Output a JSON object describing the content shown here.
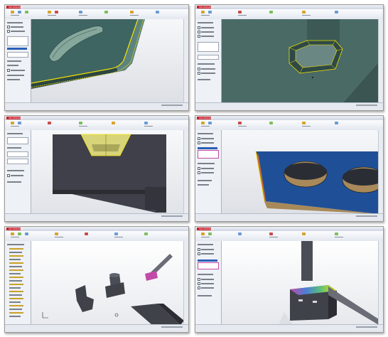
{
  "app": {
    "logo_text": "SOLIDWORKS",
    "accent_red": "#c8202a",
    "selection_color": "#f2e300",
    "face_dark_green": "#33504d",
    "face_steel": "#3d3f47",
    "face_blue": "#1f4f97",
    "face_tan": "#a8895a"
  },
  "panels": [
    {
      "id": "fillet-pocket-edge",
      "feature": "fillet",
      "model_color": "#3f6562"
    },
    {
      "id": "fillet-square-pocket",
      "feature": "fillet",
      "model_color": "#4a6a66"
    },
    {
      "id": "tapered-pocket-section",
      "feature": "section-view",
      "model_color": "#3f4049"
    },
    {
      "id": "plate-two-holes",
      "feature": "cut",
      "model_color": "#1f4f97"
    },
    {
      "id": "assembly-parts",
      "feature": "assembly",
      "model_color": "#40424a"
    },
    {
      "id": "assembly-colored-mate",
      "feature": "assembly",
      "model_color": "#40424a"
    }
  ]
}
